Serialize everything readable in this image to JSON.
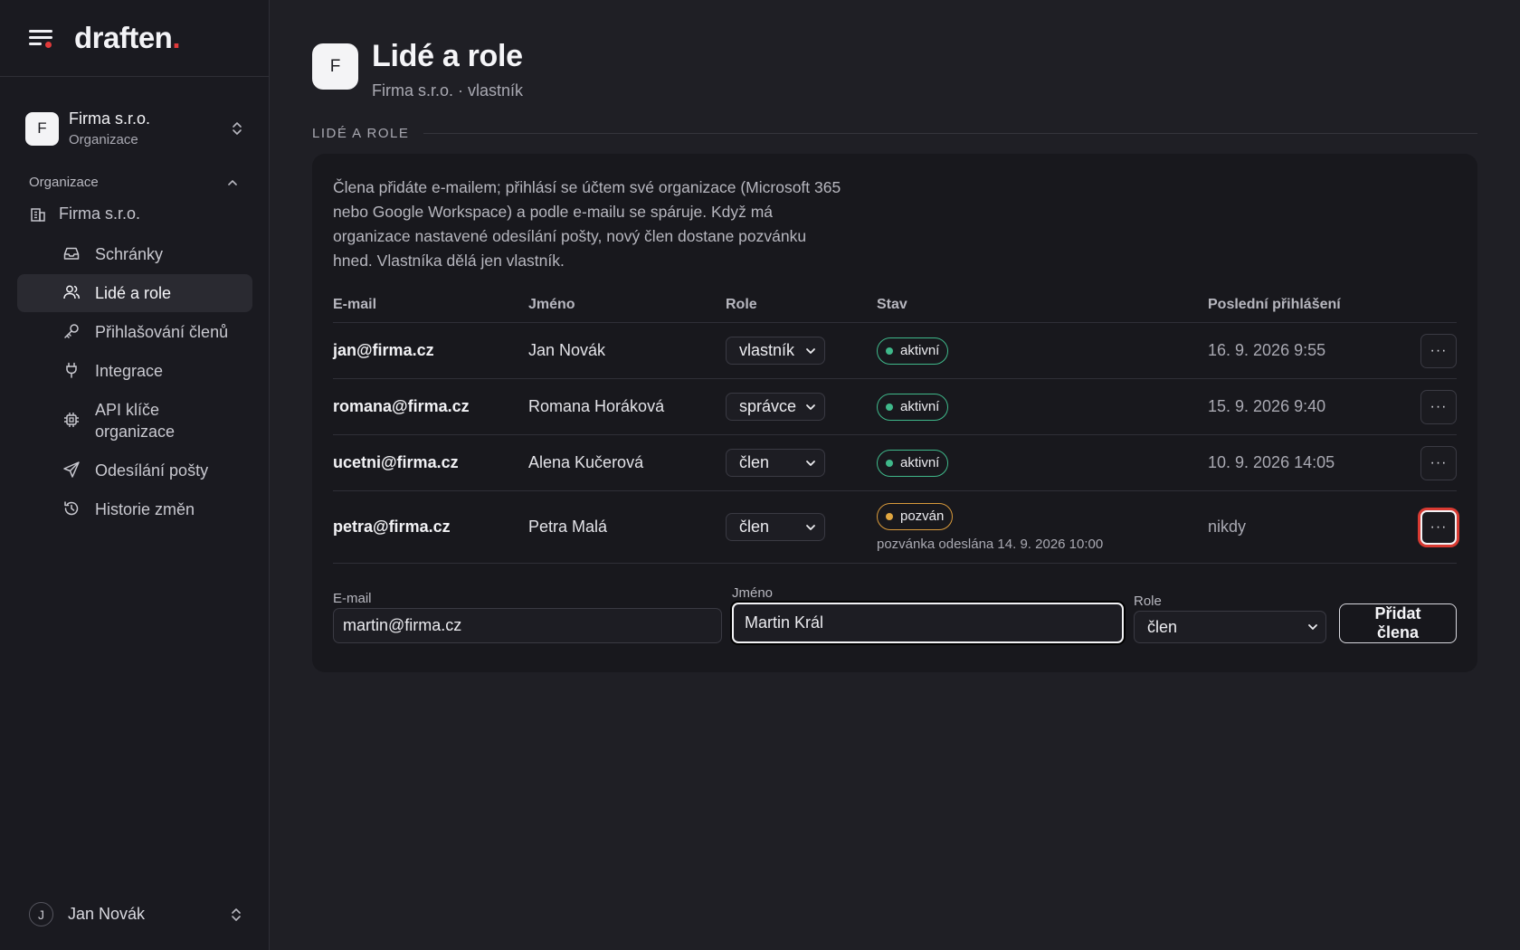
{
  "brand": {
    "logo_text": "draften",
    "logo_dot": ".",
    "accent": "#e03a3a"
  },
  "org_switcher": {
    "avatar_letter": "F",
    "name": "Firma s.r.o.",
    "type": "Organizace"
  },
  "sidebar": {
    "group_label": "Organizace",
    "org_item": "Firma s.r.o.",
    "items": [
      {
        "label": "Schránky",
        "icon": "inbox-icon"
      },
      {
        "label": "Lidé a role",
        "icon": "users-icon",
        "active": true
      },
      {
        "label": "Přihlašování členů",
        "icon": "key-icon"
      },
      {
        "label": "Integrace",
        "icon": "plug-icon"
      },
      {
        "label": "API klíče organizace",
        "icon": "chip-icon"
      },
      {
        "label": "Odesílání pošty",
        "icon": "send-icon"
      },
      {
        "label": "Historie změn",
        "icon": "history-icon"
      }
    ],
    "user": {
      "initial": "J",
      "name": "Jan Novák"
    }
  },
  "page": {
    "avatar_letter": "F",
    "title": "Lidé a role",
    "subtitle": "Firma s.r.o. · vlastník",
    "section_label": "LIDÉ A ROLE",
    "intro": "Člena přidáte e-mailem; přihlásí se účtem své organizace (Microsoft 365 nebo Google Workspace) a podle e-mailu se spáruje. Když má organizace nastavené odesílání pošty, nový člen dostane pozvánku hned. Vlastníka dělá jen vlastník."
  },
  "table": {
    "headers": {
      "email": "E-mail",
      "name": "Jméno",
      "role": "Role",
      "status": "Stav",
      "last_login": "Poslední přihlášení"
    },
    "rows": [
      {
        "email": "jan@firma.cz",
        "name": "Jan Novák",
        "role": "vlastník",
        "status": "aktivní",
        "status_color": "#3fb88a",
        "note": "",
        "last_login": "16. 9. 2026 9:55"
      },
      {
        "email": "romana@firma.cz",
        "name": "Romana Horáková",
        "role": "správce",
        "status": "aktivní",
        "status_color": "#3fb88a",
        "note": "",
        "last_login": "15. 9. 2026 9:40"
      },
      {
        "email": "ucetni@firma.cz",
        "name": "Alena Kučerová",
        "role": "člen",
        "status": "aktivní",
        "status_color": "#3fb88a",
        "note": "",
        "last_login": "10. 9. 2026 14:05"
      },
      {
        "email": "petra@firma.cz",
        "name": "Petra Malá",
        "role": "člen",
        "status": "pozván",
        "status_color": "#e0a640",
        "note": "pozvánka odeslána 14. 9. 2026 10:00",
        "last_login": "nikdy"
      }
    ],
    "more_label": "···"
  },
  "add_form": {
    "email_label": "E-mail",
    "email_value": "martin@firma.cz",
    "name_label": "Jméno",
    "name_value": "Martin Král",
    "role_label": "Role",
    "role_value": "člen",
    "submit_label": "Přidat člena"
  }
}
